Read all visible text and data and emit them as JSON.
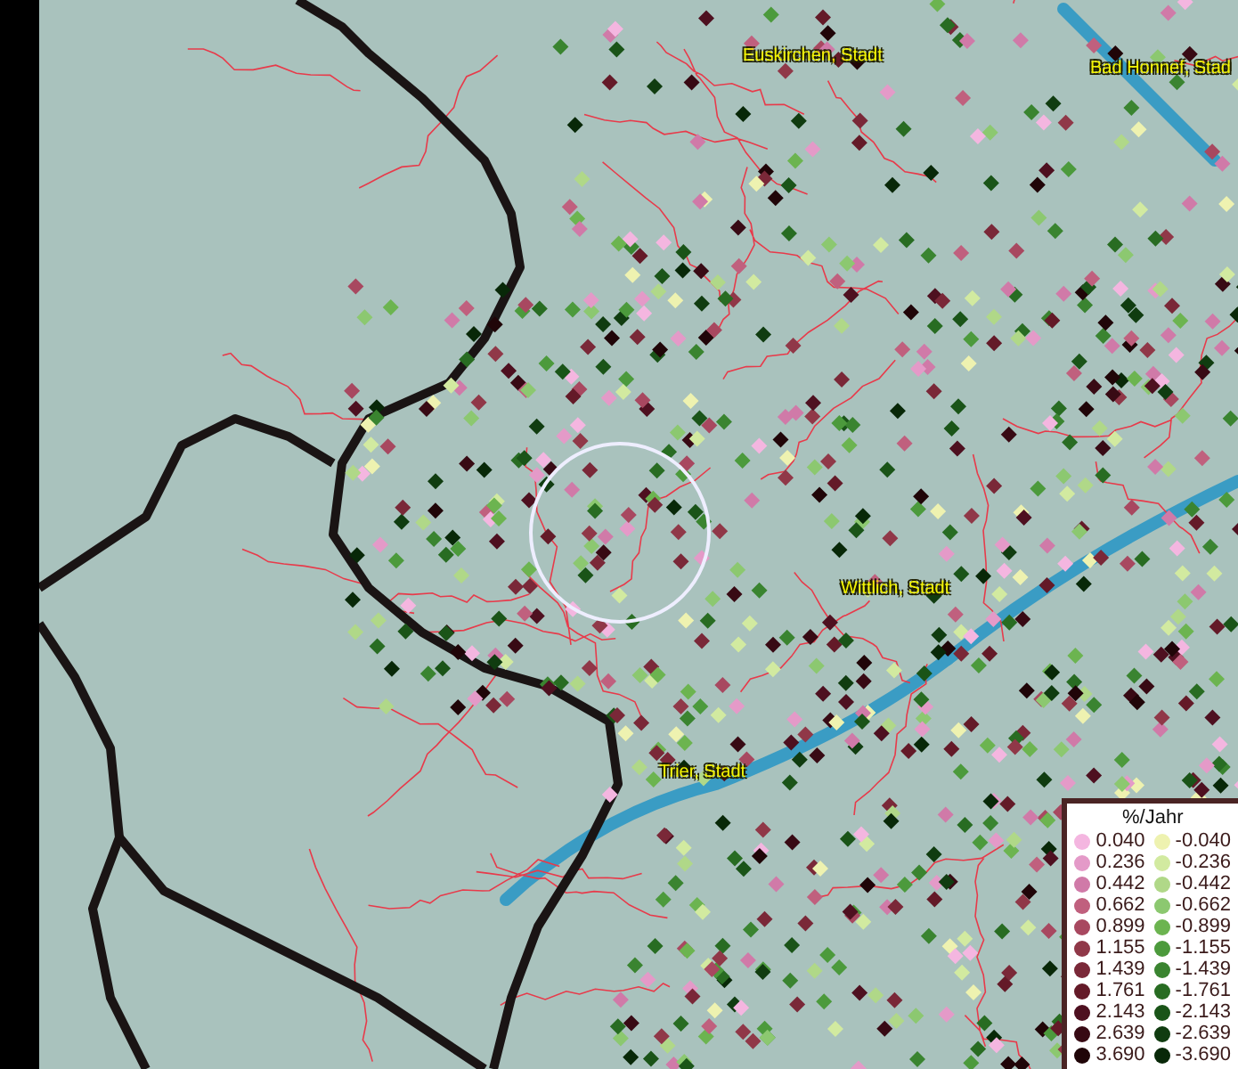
{
  "map": {
    "places": [
      {
        "name": "Euskirchen, Stadt"
      },
      {
        "name": "Bad Honnef, Stad"
      },
      {
        "name": "Wittlich, Stadt"
      },
      {
        "name": "Trier, Stadt"
      }
    ]
  },
  "legend": {
    "title": "%/Jahr",
    "positive": [
      {
        "label": "0.040",
        "color": "#f4b6e0"
      },
      {
        "label": "0.236",
        "color": "#e49ac8"
      },
      {
        "label": "0.442",
        "color": "#d07aa8"
      },
      {
        "label": "0.662",
        "color": "#c0607e"
      },
      {
        "label": "0.899",
        "color": "#a84860"
      },
      {
        "label": "1.155",
        "color": "#903848"
      },
      {
        "label": "1.439",
        "color": "#7a2838"
      },
      {
        "label": "1.761",
        "color": "#641a28"
      },
      {
        "label": "2.143",
        "color": "#4e1020"
      },
      {
        "label": "2.639",
        "color": "#380a14"
      },
      {
        "label": "3.690",
        "color": "#200508"
      }
    ],
    "negative": [
      {
        "label": "-0.040",
        "color": "#eef2b0"
      },
      {
        "label": "-0.236",
        "color": "#d2eaa0"
      },
      {
        "label": "-0.442",
        "color": "#b0d888"
      },
      {
        "label": "-0.662",
        "color": "#8cc870"
      },
      {
        "label": "-0.899",
        "color": "#6cb450"
      },
      {
        "label": "-1.155",
        "color": "#4c9a3c"
      },
      {
        "label": "-1.439",
        "color": "#3a8430"
      },
      {
        "label": "-1.761",
        "color": "#286c22"
      },
      {
        "label": "-2.143",
        "color": "#1a5418"
      },
      {
        "label": "-2.639",
        "color": "#103c10"
      },
      {
        "label": "-3.690",
        "color": "#082808"
      }
    ]
  }
}
